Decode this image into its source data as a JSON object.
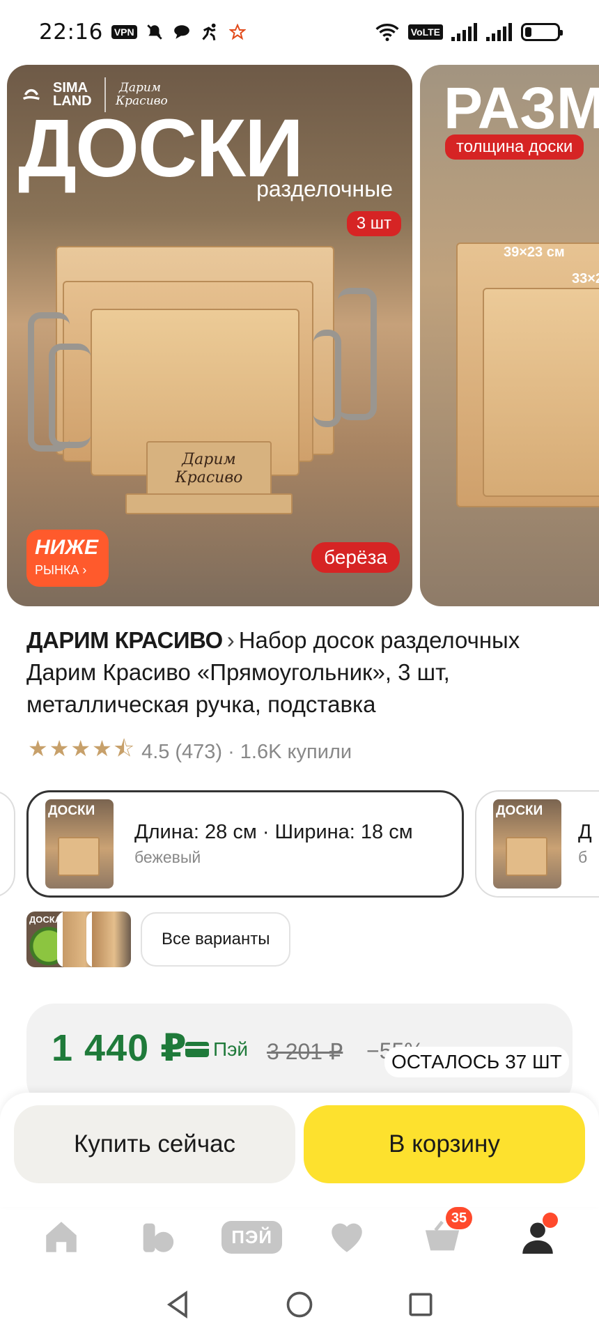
{
  "status_bar": {
    "time": "22:16",
    "vpn_label": "VPN",
    "volte_label": "VoLTE",
    "icons": [
      "vpn-icon",
      "mute-icon",
      "chat-icon",
      "activity-icon",
      "star-icon",
      "wifi-icon",
      "signal-icon",
      "signal-icon",
      "battery-icon"
    ],
    "battery_level": 0.2
  },
  "gallery": {
    "slides": [
      {
        "logo_brand": "SIMA LAND",
        "logo_brand2": "Дарим Красиво",
        "title": "ДОСКИ",
        "subtitle": "разделочные",
        "quantity_tag": "3 шт",
        "stand_text": "Дарим Красиво",
        "promo_line1": "НИЖЕ",
        "promo_line2": "РЫНКА ›",
        "material_tag": "берёза"
      },
      {
        "title": "РАЗМ",
        "tag": "толщина доски",
        "dim1": "39×23 см",
        "dim2": "33×2"
      }
    ]
  },
  "product": {
    "brand": "ДАРИМ КРАСИВО",
    "brand_chevron": "›",
    "name": "Набор досок разделочных Дарим Красиво «Прямоугольник», 3 шт, металлическая ручка, подставка",
    "stars": "★★★★⯪",
    "rating": "4.5",
    "reviews": "(473)",
    "sold": "· 1.6K купили"
  },
  "variants": {
    "selected": {
      "label": "Длина: 28 см · Ширина: 18 см",
      "color": "бежевый",
      "thumb_text": "ДОСКИ"
    },
    "next": {
      "label": "Д",
      "color": "б",
      "thumb_text": "ДОСКИ"
    },
    "mini_thumb_text": "ДОСКА",
    "all_variants_label": "Все варианты"
  },
  "price": {
    "current": "1 440 ₽",
    "pay_label": "Пэй",
    "old": "3 201 ₽",
    "discount": "−55%",
    "remaining": "ОСТАЛОСЬ 37 ШТ"
  },
  "actions": {
    "buy_now": "Купить сейчас",
    "add_to_cart": "В корзину"
  },
  "tabbar": {
    "pay_label": "ПЭЙ",
    "cart_count": "35",
    "icon_color": "#c6c6c6",
    "active_icon_color": "#2b2b2b",
    "accent": "#ff4a2c"
  },
  "colors": {
    "price_green": "#1f7a3a",
    "cart_yellow": "#fde12e",
    "promo_orange": "#ff5a2c",
    "tag_red": "#d62424"
  }
}
